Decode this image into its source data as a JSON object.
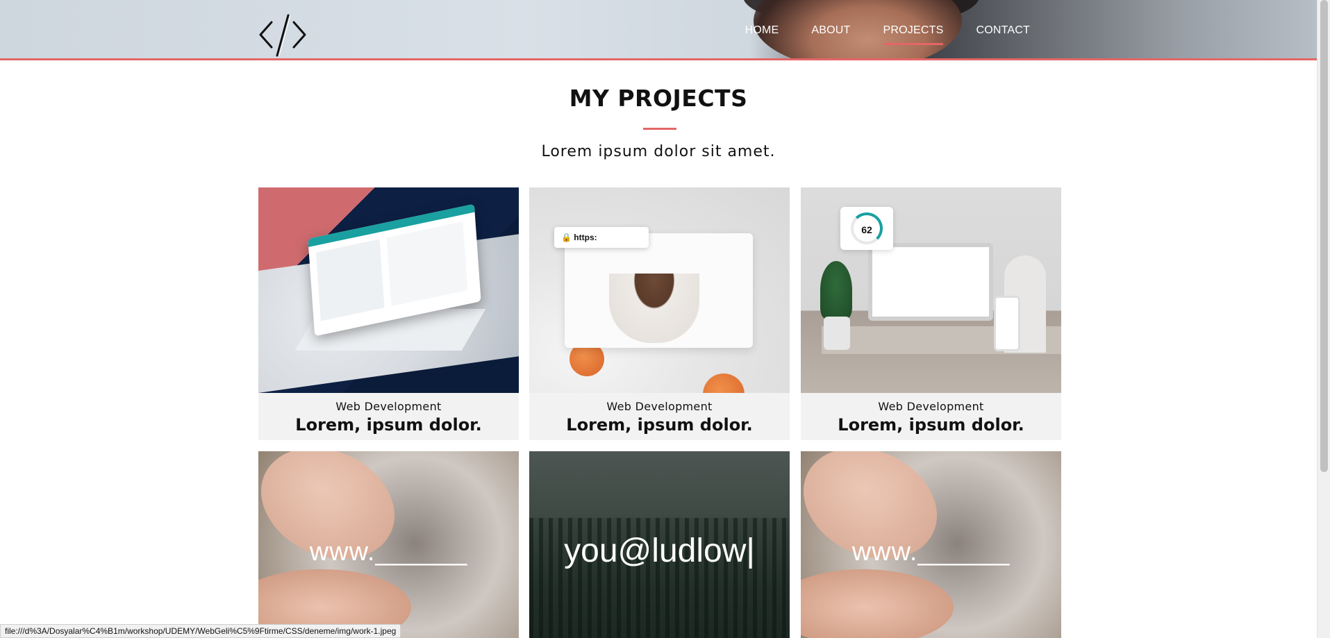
{
  "nav": {
    "items": [
      "HOME",
      "ABOUT",
      "PROJECTS",
      "CONTACT"
    ],
    "active": "PROJECTS"
  },
  "section": {
    "title": "MY PROJECTS",
    "subtitle": "Lorem ipsum dolor sit amet."
  },
  "cards": [
    {
      "category": "Web Development",
      "title": "Lorem, ipsum dolor."
    },
    {
      "category": "Web Development",
      "title": "Lorem, ipsum dolor."
    },
    {
      "category": "Web Development",
      "title": "Lorem, ipsum dolor."
    }
  ],
  "media_text": {
    "url_bar": "https:",
    "gauge_value": "62",
    "pottery_overlay": "www.______",
    "email_overlay": "you@ludlow|"
  },
  "statusbar": {
    "url": "file:///d%3A/Dosyalar%C4%B1m/workshop/UDEMY/WebGeli%C5%9Ftirme/CSS/deneme/img/work-1.jpeg"
  },
  "colors": {
    "accent": "#e36666",
    "card_bg": "#f2f2f2"
  }
}
